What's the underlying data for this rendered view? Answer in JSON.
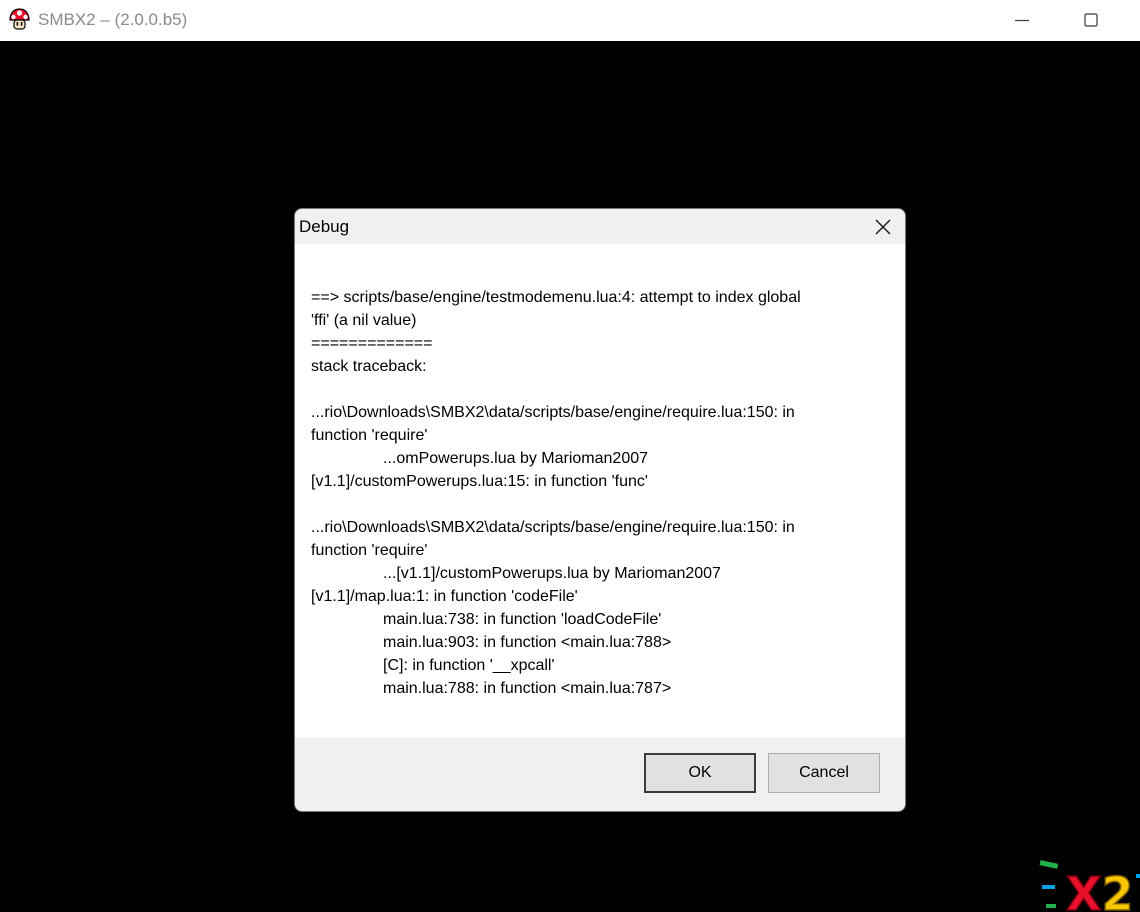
{
  "window": {
    "title": "SMBX2 – (2.0.0.b5)",
    "icon": "mushroom-icon"
  },
  "dialog": {
    "title": "Debug",
    "message_lines": [
      {
        "text": "==> scripts/base/engine/testmodemenu.lua:4: attempt to index global",
        "indent": false
      },
      {
        "text": "'ffi' (a nil value)",
        "indent": false
      },
      {
        "text": "=============",
        "indent": false
      },
      {
        "text": "stack traceback:",
        "indent": false
      },
      {
        "text": "",
        "indent": false
      },
      {
        "text": "...rio\\Downloads\\SMBX2\\data/scripts/base/engine/require.lua:150: in",
        "indent": false
      },
      {
        "text": "function 'require'",
        "indent": false
      },
      {
        "text": "...omPowerups.lua by Marioman2007",
        "indent": true
      },
      {
        "text": "[v1.1]/customPowerups.lua:15: in function 'func'",
        "indent": false
      },
      {
        "text": "",
        "indent": false
      },
      {
        "text": "...rio\\Downloads\\SMBX2\\data/scripts/base/engine/require.lua:150: in",
        "indent": false
      },
      {
        "text": "function 'require'",
        "indent": false
      },
      {
        "text": "...[v1.1]/customPowerups.lua by Marioman2007",
        "indent": true
      },
      {
        "text": "[v1.1]/map.lua:1: in function 'codeFile'",
        "indent": false
      },
      {
        "text": "main.lua:738: in function 'loadCodeFile'",
        "indent": true
      },
      {
        "text": "main.lua:903: in function <main.lua:788>",
        "indent": true
      },
      {
        "text": "[C]: in function '__xpcall'",
        "indent": true
      },
      {
        "text": "main.lua:788: in function <main.lua:787>",
        "indent": true
      }
    ],
    "buttons": {
      "ok": "OK",
      "cancel": "Cancel"
    }
  },
  "logo": {
    "text": "X2"
  },
  "colors": {
    "background": "#000000",
    "titlebar": "#ffffff",
    "dialog_body": "#ffffff",
    "dialog_frame": "#f0f0f0",
    "button": "#e1e1e1",
    "logo_red": "#e8102a",
    "logo_yellow": "#f7c600",
    "logo_green": "#22b14c",
    "logo_cyan": "#00a2e8"
  }
}
